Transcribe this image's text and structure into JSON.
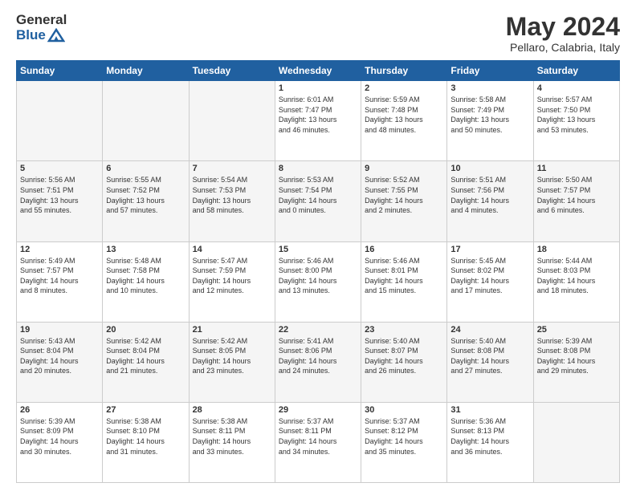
{
  "logo": {
    "general": "General",
    "blue": "Blue"
  },
  "header": {
    "month_year": "May 2024",
    "location": "Pellaro, Calabria, Italy"
  },
  "days_of_week": [
    "Sunday",
    "Monday",
    "Tuesday",
    "Wednesday",
    "Thursday",
    "Friday",
    "Saturday"
  ],
  "weeks": [
    [
      {
        "num": "",
        "detail": ""
      },
      {
        "num": "",
        "detail": ""
      },
      {
        "num": "",
        "detail": ""
      },
      {
        "num": "1",
        "detail": "Sunrise: 6:01 AM\nSunset: 7:47 PM\nDaylight: 13 hours\nand 46 minutes."
      },
      {
        "num": "2",
        "detail": "Sunrise: 5:59 AM\nSunset: 7:48 PM\nDaylight: 13 hours\nand 48 minutes."
      },
      {
        "num": "3",
        "detail": "Sunrise: 5:58 AM\nSunset: 7:49 PM\nDaylight: 13 hours\nand 50 minutes."
      },
      {
        "num": "4",
        "detail": "Sunrise: 5:57 AM\nSunset: 7:50 PM\nDaylight: 13 hours\nand 53 minutes."
      }
    ],
    [
      {
        "num": "5",
        "detail": "Sunrise: 5:56 AM\nSunset: 7:51 PM\nDaylight: 13 hours\nand 55 minutes."
      },
      {
        "num": "6",
        "detail": "Sunrise: 5:55 AM\nSunset: 7:52 PM\nDaylight: 13 hours\nand 57 minutes."
      },
      {
        "num": "7",
        "detail": "Sunrise: 5:54 AM\nSunset: 7:53 PM\nDaylight: 13 hours\nand 58 minutes."
      },
      {
        "num": "8",
        "detail": "Sunrise: 5:53 AM\nSunset: 7:54 PM\nDaylight: 14 hours\nand 0 minutes."
      },
      {
        "num": "9",
        "detail": "Sunrise: 5:52 AM\nSunset: 7:55 PM\nDaylight: 14 hours\nand 2 minutes."
      },
      {
        "num": "10",
        "detail": "Sunrise: 5:51 AM\nSunset: 7:56 PM\nDaylight: 14 hours\nand 4 minutes."
      },
      {
        "num": "11",
        "detail": "Sunrise: 5:50 AM\nSunset: 7:57 PM\nDaylight: 14 hours\nand 6 minutes."
      }
    ],
    [
      {
        "num": "12",
        "detail": "Sunrise: 5:49 AM\nSunset: 7:57 PM\nDaylight: 14 hours\nand 8 minutes."
      },
      {
        "num": "13",
        "detail": "Sunrise: 5:48 AM\nSunset: 7:58 PM\nDaylight: 14 hours\nand 10 minutes."
      },
      {
        "num": "14",
        "detail": "Sunrise: 5:47 AM\nSunset: 7:59 PM\nDaylight: 14 hours\nand 12 minutes."
      },
      {
        "num": "15",
        "detail": "Sunrise: 5:46 AM\nSunset: 8:00 PM\nDaylight: 14 hours\nand 13 minutes."
      },
      {
        "num": "16",
        "detail": "Sunrise: 5:46 AM\nSunset: 8:01 PM\nDaylight: 14 hours\nand 15 minutes."
      },
      {
        "num": "17",
        "detail": "Sunrise: 5:45 AM\nSunset: 8:02 PM\nDaylight: 14 hours\nand 17 minutes."
      },
      {
        "num": "18",
        "detail": "Sunrise: 5:44 AM\nSunset: 8:03 PM\nDaylight: 14 hours\nand 18 minutes."
      }
    ],
    [
      {
        "num": "19",
        "detail": "Sunrise: 5:43 AM\nSunset: 8:04 PM\nDaylight: 14 hours\nand 20 minutes."
      },
      {
        "num": "20",
        "detail": "Sunrise: 5:42 AM\nSunset: 8:04 PM\nDaylight: 14 hours\nand 21 minutes."
      },
      {
        "num": "21",
        "detail": "Sunrise: 5:42 AM\nSunset: 8:05 PM\nDaylight: 14 hours\nand 23 minutes."
      },
      {
        "num": "22",
        "detail": "Sunrise: 5:41 AM\nSunset: 8:06 PM\nDaylight: 14 hours\nand 24 minutes."
      },
      {
        "num": "23",
        "detail": "Sunrise: 5:40 AM\nSunset: 8:07 PM\nDaylight: 14 hours\nand 26 minutes."
      },
      {
        "num": "24",
        "detail": "Sunrise: 5:40 AM\nSunset: 8:08 PM\nDaylight: 14 hours\nand 27 minutes."
      },
      {
        "num": "25",
        "detail": "Sunrise: 5:39 AM\nSunset: 8:08 PM\nDaylight: 14 hours\nand 29 minutes."
      }
    ],
    [
      {
        "num": "26",
        "detail": "Sunrise: 5:39 AM\nSunset: 8:09 PM\nDaylight: 14 hours\nand 30 minutes."
      },
      {
        "num": "27",
        "detail": "Sunrise: 5:38 AM\nSunset: 8:10 PM\nDaylight: 14 hours\nand 31 minutes."
      },
      {
        "num": "28",
        "detail": "Sunrise: 5:38 AM\nSunset: 8:11 PM\nDaylight: 14 hours\nand 33 minutes."
      },
      {
        "num": "29",
        "detail": "Sunrise: 5:37 AM\nSunset: 8:11 PM\nDaylight: 14 hours\nand 34 minutes."
      },
      {
        "num": "30",
        "detail": "Sunrise: 5:37 AM\nSunset: 8:12 PM\nDaylight: 14 hours\nand 35 minutes."
      },
      {
        "num": "31",
        "detail": "Sunrise: 5:36 AM\nSunset: 8:13 PM\nDaylight: 14 hours\nand 36 minutes."
      },
      {
        "num": "",
        "detail": ""
      }
    ]
  ]
}
